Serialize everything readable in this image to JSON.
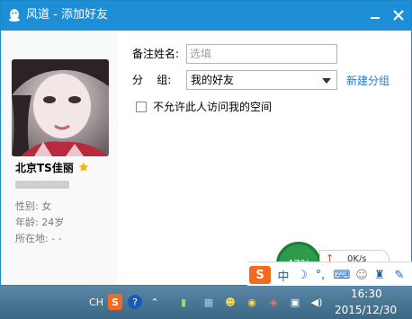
{
  "window": {
    "title": "风道 - 添加好友"
  },
  "profile": {
    "nickname": "北京TS佳丽",
    "gender_label": "性别: 女",
    "age_label": "年龄: 24岁",
    "location_label": "所在地:  -    -"
  },
  "form": {
    "remark_label": "备注姓名:",
    "remark_placeholder": "选填",
    "group_label": "分    组:",
    "group_value": "我的好友",
    "new_group_link": "新建分组",
    "privacy_checkbox_label": "不允许此人访问我的空间",
    "privacy_checked": false
  },
  "speed_widget": {
    "percent": "47%",
    "net_speed": "0K/s"
  },
  "ime_bar": {
    "mode": "中"
  },
  "taskbar": {
    "lang": "CH",
    "time": "16:30",
    "date": "2015/12/30"
  },
  "colors": {
    "titlebar": "#1e8fd6",
    "link": "#2a78c8",
    "taskbar": "#3a6783"
  }
}
